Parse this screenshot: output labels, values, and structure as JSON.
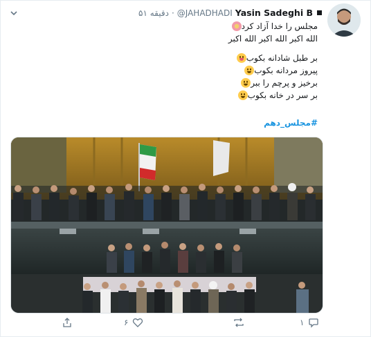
{
  "tweet": {
    "author_name": "Yasin Sadeghi B",
    "handle": "@JAHADHADI",
    "separator": "·",
    "time": "۵۱ دقیقه",
    "lines": [
      "مجلس را خدا آزاد کرد",
      "الله اکبر الله اکبر الله اکبر",
      "بر طبل شادانه بکوب",
      "پیروز مردانه بکوب",
      "برخیز و پرچم را ببر",
      "بر سر در خانه بکوب"
    ],
    "hashtag": "#مجلس_دهم"
  },
  "actions": {
    "reply_count": "۱",
    "retweet_count": "",
    "like_count": "۶",
    "share_label": ""
  },
  "icons": {
    "chevron": "chevron-down-icon",
    "reply": "reply-icon",
    "retweet": "retweet-icon",
    "like": "heart-icon",
    "share": "share-icon"
  },
  "colors": {
    "link": "#1b95e0",
    "secondary": "#657786",
    "text": "#14171a"
  }
}
